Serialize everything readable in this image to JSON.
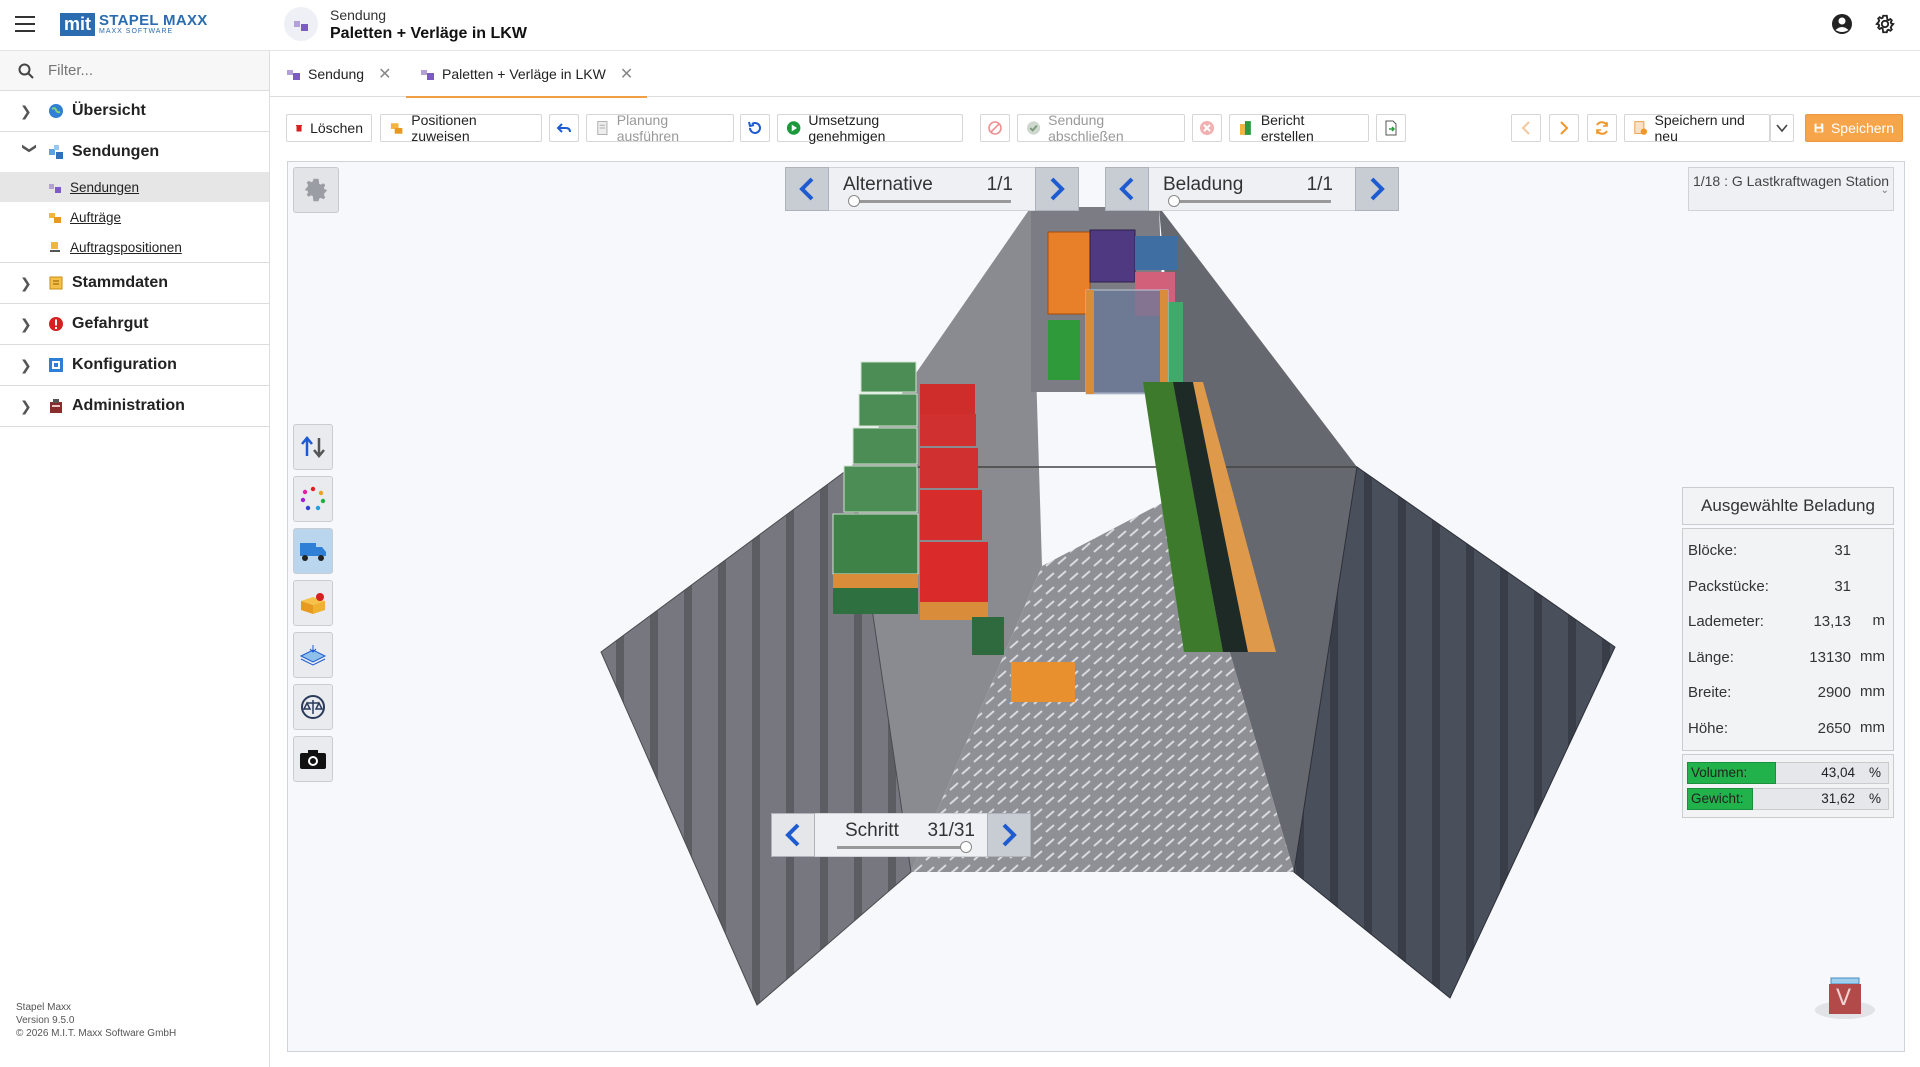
{
  "app": {
    "brand_mark": "mit",
    "brand_name": "STAPEL MAXX",
    "brand_sub": "MAXX SOFTWARE",
    "title_sub": "Sendung",
    "title_main": "Paletten + Verläge in LKW"
  },
  "sidebar": {
    "filter_placeholder": "Filter...",
    "items": [
      {
        "label": "Übersicht",
        "icon": "globe-icon",
        "expanded": false
      },
      {
        "label": "Sendungen",
        "icon": "shipments-icon",
        "expanded": true,
        "children": [
          {
            "label": "Sendungen",
            "icon": "shipments-icon",
            "active": true
          },
          {
            "label": "Aufträge",
            "icon": "orders-icon",
            "active": false
          },
          {
            "label": "Auftragspositionen",
            "icon": "order-positions-icon",
            "active": false
          }
        ]
      },
      {
        "label": "Stammdaten",
        "icon": "master-data-icon",
        "expanded": false
      },
      {
        "label": "Gefahrgut",
        "icon": "hazard-icon",
        "expanded": false
      },
      {
        "label": "Konfiguration",
        "icon": "configuration-icon",
        "expanded": false
      },
      {
        "label": "Administration",
        "icon": "administration-icon",
        "expanded": false
      }
    ],
    "footer": [
      "Stapel Maxx",
      "Version 9.5.0",
      "© 2026 M.I.T. Maxx Software GmbH"
    ]
  },
  "tabs": [
    {
      "label": "Sendung",
      "active": false
    },
    {
      "label": "Paletten + Verläge in LKW",
      "active": true
    }
  ],
  "toolbar": {
    "delete": "Löschen",
    "assign_positions": "Positionen zuweisen",
    "run_planning": "Planung ausführen",
    "approve": "Umsetzung genehmigen",
    "close_shipment": "Sendung abschließen",
    "create_report": "Bericht erstellen",
    "save_and_new": "Speichern und neu",
    "save": "Speichern"
  },
  "viewer": {
    "alternative": {
      "label": "Alternative",
      "value": "1/1",
      "position": 0
    },
    "loading": {
      "label": "Beladung",
      "value": "1/1",
      "position": 0
    },
    "step": {
      "label": "Schritt",
      "value": "31/31",
      "position": 1
    },
    "vehicle": "1/18 : G Lastkraftwagen Station",
    "corner_badge": "V"
  },
  "stats": {
    "header": "Ausgewählte Beladung",
    "rows": [
      {
        "key": "Blöcke:",
        "value": "31",
        "unit": ""
      },
      {
        "key": "Packstücke:",
        "value": "31",
        "unit": ""
      },
      {
        "key": "Lademeter:",
        "value": "13,13",
        "unit": "m"
      },
      {
        "key": "Länge:",
        "value": "13130",
        "unit": "mm"
      },
      {
        "key": "Breite:",
        "value": "2900",
        "unit": "mm"
      },
      {
        "key": "Höhe:",
        "value": "2650",
        "unit": "mm"
      }
    ],
    "bars": [
      {
        "key": "Volumen:",
        "value": "43,04",
        "unit": "%",
        "fraction": 0.4304
      },
      {
        "key": "Gewicht:",
        "value": "31,62",
        "unit": "%",
        "fraction": 0.3162
      }
    ]
  },
  "colors": {
    "accent": "#f7a54a",
    "brand": "#2b6cb0",
    "nav_arrow": "#1e5bd0",
    "bar_fill": "#21b24b"
  }
}
